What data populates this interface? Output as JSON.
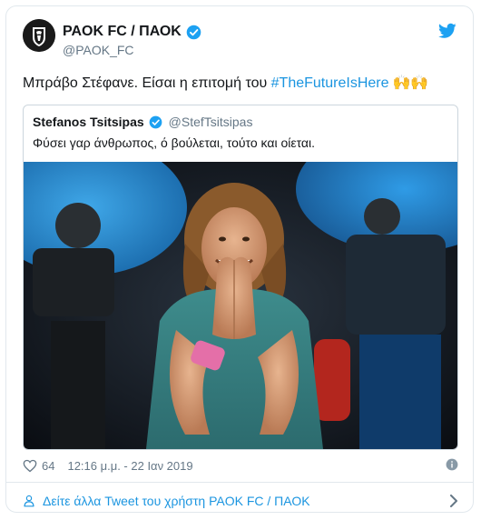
{
  "author": {
    "display_name": "PAOK FC / ΠΑΟΚ",
    "handle": "@PAOK_FC",
    "avatar_icon": "paok-crest-icon"
  },
  "tweet": {
    "text_before": "Μπράβο Στέφανε. Είσαι η επιτομή του ",
    "hashtag": "#TheFutureIsHere",
    "emoji": "🙌🙌"
  },
  "quoted": {
    "display_name": "Stefanos Tsitsipas",
    "handle": "@StefTsitsipas",
    "text": "Φύσει γαρ άνθρωπος, ό βούλεται, τούτο και οίεται."
  },
  "meta": {
    "likes": "64",
    "timestamp": "12:16 μ.μ. - 22 Ιαν 2019"
  },
  "footer": {
    "more_link": "Δείτε άλλα Tweet του χρήστη PAOK FC / ΠΑΟΚ"
  },
  "colors": {
    "link": "#1b95e0",
    "verified": "#1da1f2",
    "secondary_text": "#657786"
  }
}
